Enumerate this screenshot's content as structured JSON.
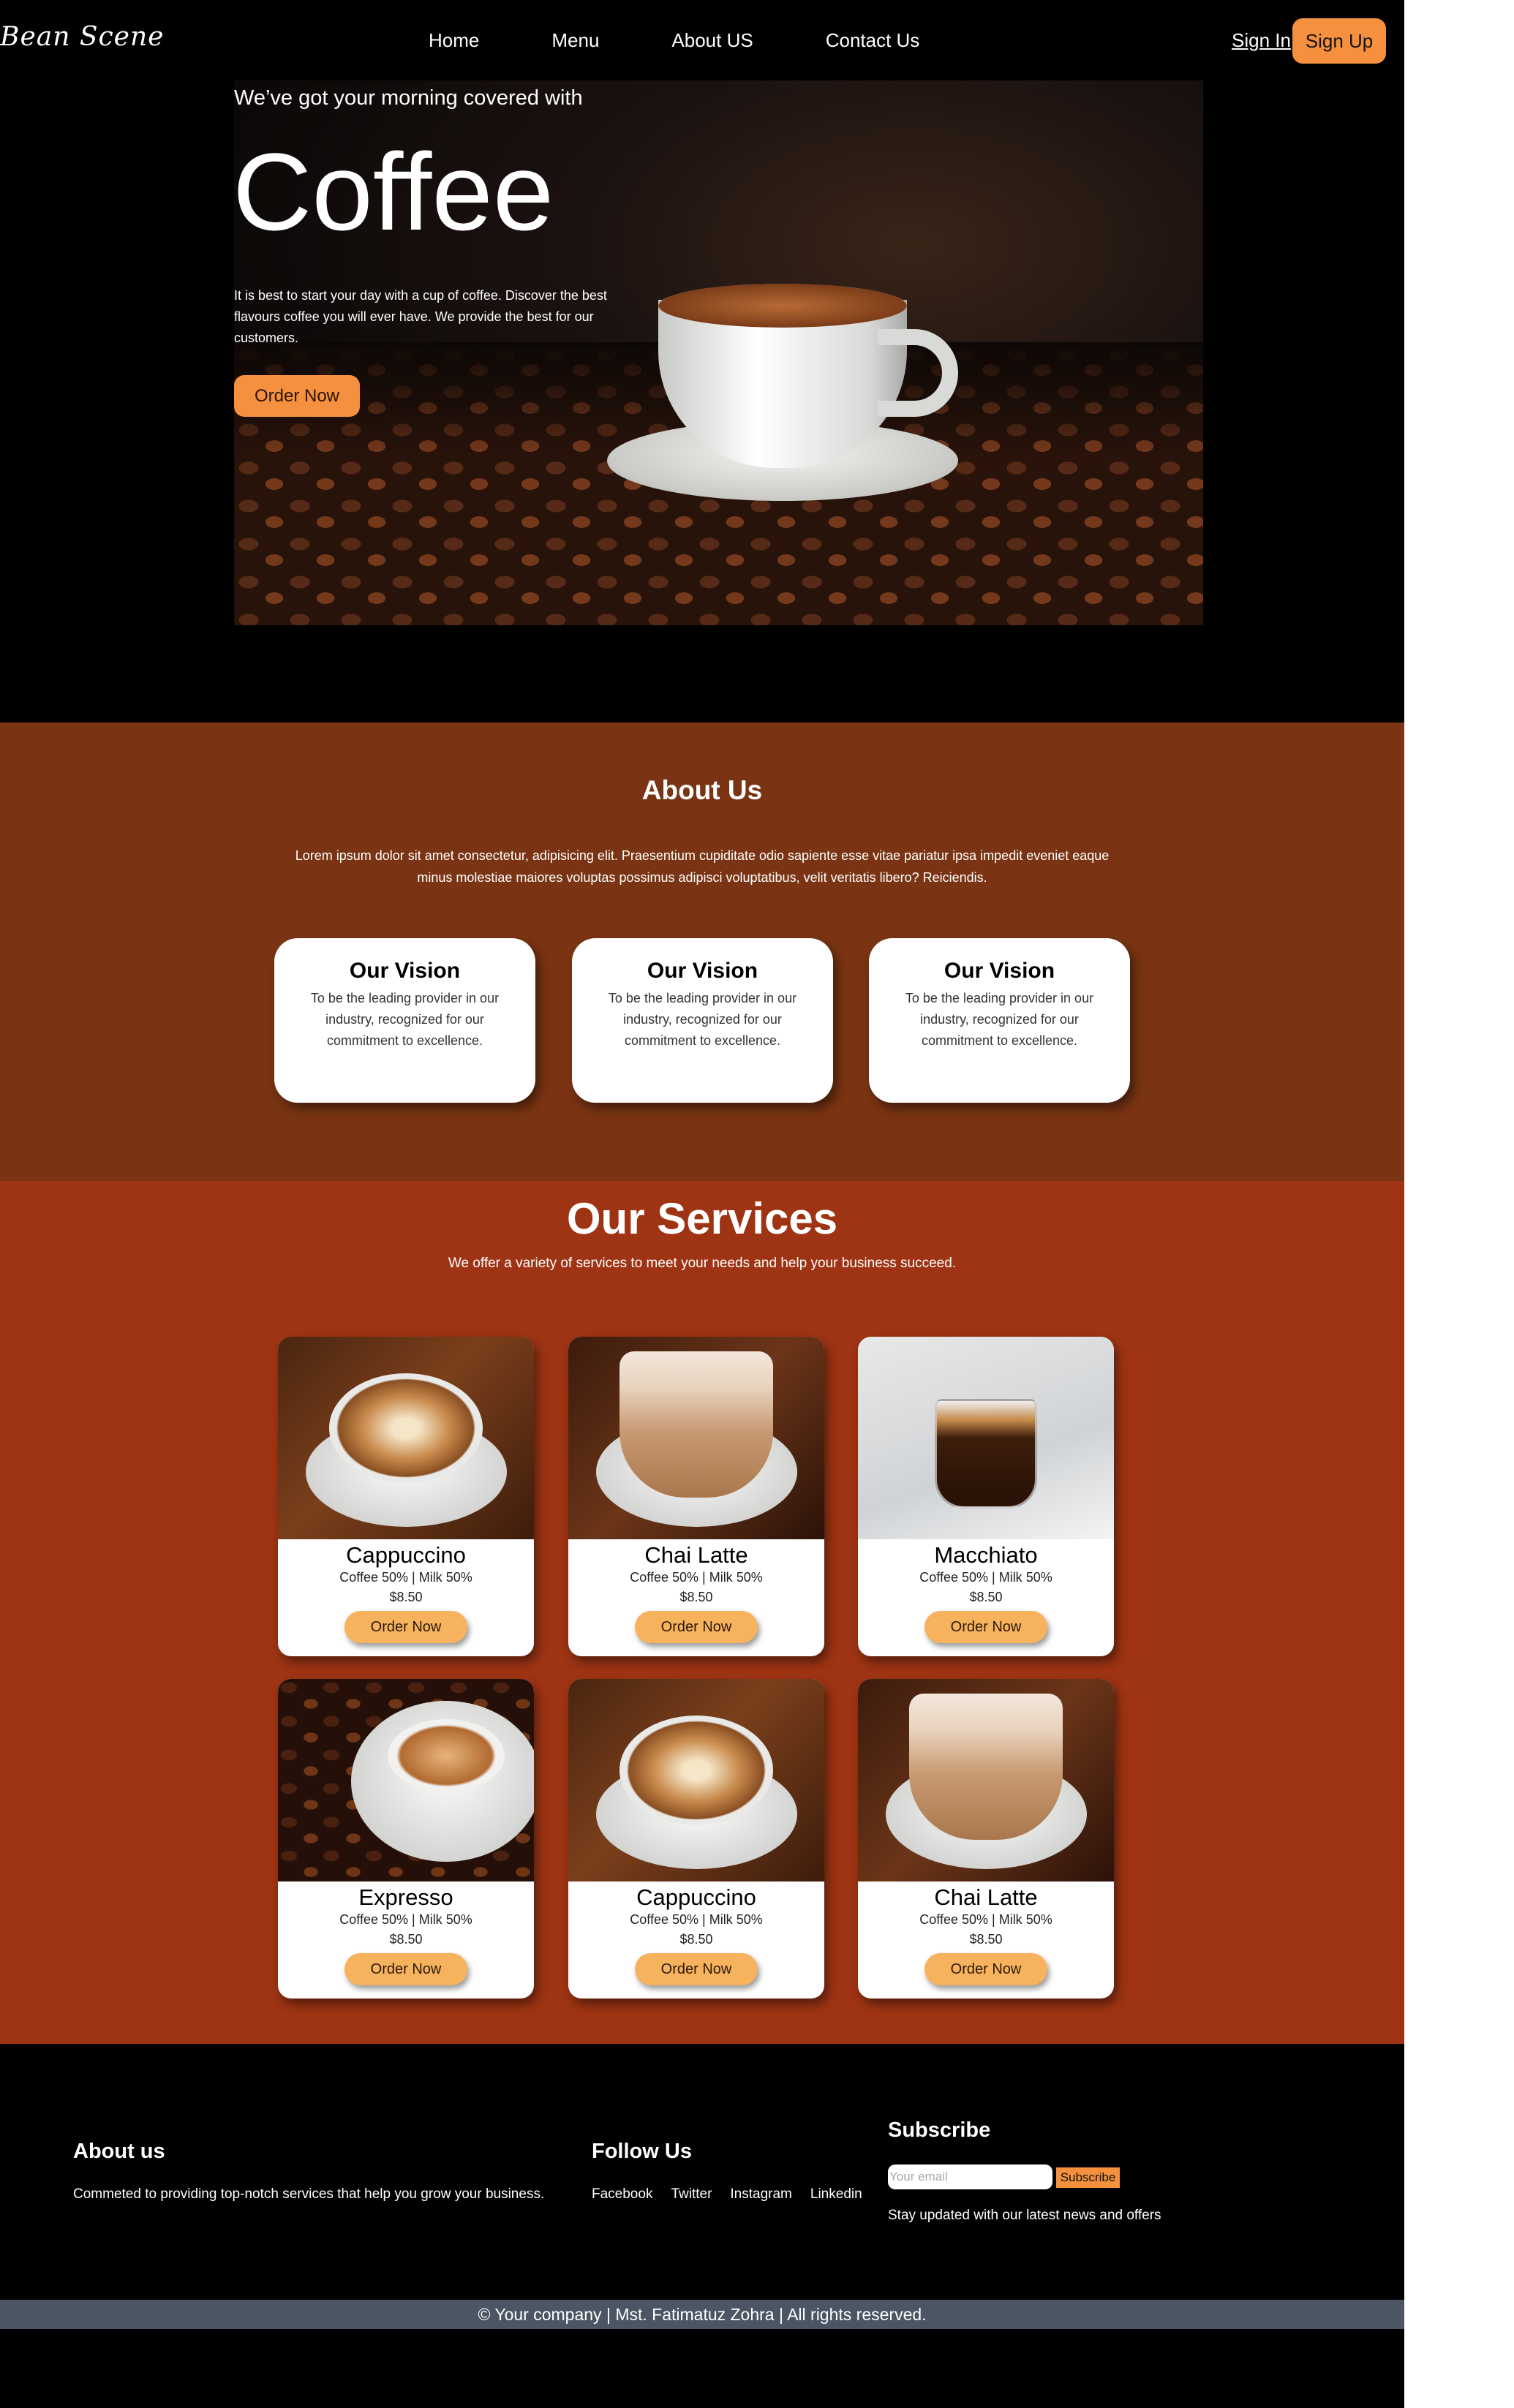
{
  "nav": {
    "logo": "Bean Scene",
    "links": [
      "Home",
      "Menu",
      "About US",
      "Contact Us"
    ],
    "sign_in": "Sign In",
    "sign_up": "Sign Up"
  },
  "hero": {
    "tagline": "We’ve got your morning covered with",
    "title": "Coffee",
    "description": "It is best to start your day with a cup of coffee. Discover the best flavours coffee you will ever have. We provide the best for our customers.",
    "button": "Order Now"
  },
  "about": {
    "title": "About Us",
    "text": "Lorem ipsum dolor sit amet consectetur, adipisicing elit. Praesentium cupiditate odio sapiente esse vitae pariatur ipsa impedit eveniet eaque minus molestiae maiores voluptas possimus adipisci voluptatibus, velit veritatis libero? Reiciendis.",
    "cards": [
      {
        "title": "Our Vision",
        "text": "To be the leading provider in our industry, recognized for our commitment to excellence."
      },
      {
        "title": "Our Vision",
        "text": "To be the leading provider in our industry, recognized for our commitment to excellence."
      },
      {
        "title": "Our Vision",
        "text": "To be the leading provider in our industry, recognized for our commitment to excellence."
      }
    ]
  },
  "services": {
    "title": "Our Services",
    "subtitle": "We offer a variety of services to meet your needs and help your business succeed.",
    "items": [
      {
        "name": "Cappuccino",
        "mix": "Coffee 50% | Milk 50%",
        "price": "$8.50",
        "button": "Order Now"
      },
      {
        "name": "Chai Latte",
        "mix": "Coffee 50% | Milk 50%",
        "price": "$8.50",
        "button": "Order Now"
      },
      {
        "name": "Macchiato",
        "mix": "Coffee 50% | Milk 50%",
        "price": "$8.50",
        "button": "Order Now"
      },
      {
        "name": "Expresso",
        "mix": "Coffee 50% | Milk 50%",
        "price": "$8.50",
        "button": "Order Now"
      },
      {
        "name": "Cappuccino",
        "mix": "Coffee 50% | Milk 50%",
        "price": "$8.50",
        "button": "Order Now"
      },
      {
        "name": "Chai Latte",
        "mix": "Coffee 50% | Milk 50%",
        "price": "$8.50",
        "button": "Order Now"
      }
    ]
  },
  "footer": {
    "about_title": "About us",
    "about_text": "Commeted to providing top-notch services that help you grow your business.",
    "follow_title": "Follow Us",
    "follow_links": [
      "Facebook",
      "Twitter",
      "Instagram",
      "Linkedin"
    ],
    "subscribe_title": "Subscribe",
    "email_placeholder": "Your email",
    "subscribe_button": "Subscribe",
    "subscribe_text": "Stay updated with our latest news and offers",
    "copyright": "© Your company | Mst. Fatimatuz Zohra | All rights reserved."
  },
  "colors": {
    "accent": "#f5913e",
    "about_bg": "#7a3413",
    "services_bg": "#9e3413",
    "card_button": "#f7b25d",
    "copyright_bg": "#4b5563"
  }
}
